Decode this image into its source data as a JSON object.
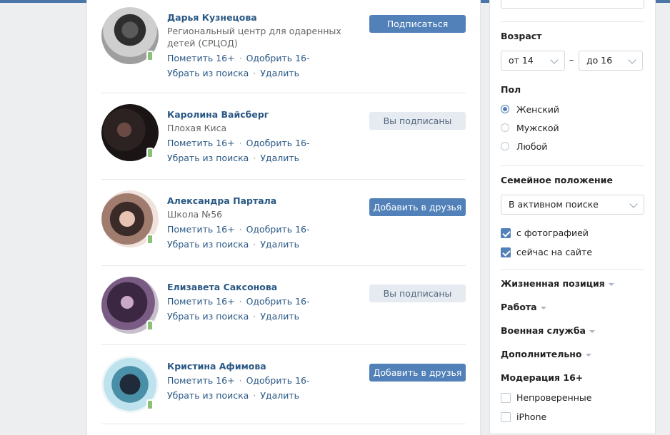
{
  "results": [
    {
      "name": "Дарья Кузнецова",
      "subtitle": "Региональный центр для одаренных детей (СРЦОД)",
      "action_label": "Подписаться",
      "action_style": "primary"
    },
    {
      "name": "Каролина Вайсберг",
      "subtitle": "Плохая Киса",
      "action_label": "Вы подписаны",
      "action_style": "secondary"
    },
    {
      "name": "Александра Партала",
      "subtitle": "Школа №56",
      "action_label": "Добавить в друзья",
      "action_style": "primary"
    },
    {
      "name": "Елизавета Саксонова",
      "subtitle": "",
      "action_label": "Вы подписаны",
      "action_style": "secondary"
    },
    {
      "name": "Кристина Афимова",
      "subtitle": "",
      "action_label": "Добавить в друзья",
      "action_style": "primary"
    }
  ],
  "moderation_links": {
    "mark_16": "Пометить 16+",
    "approve_16": "Одобрить 16-",
    "remove": "Убрать из поиска",
    "delete": "Удалить",
    "separator": "·"
  },
  "filters": {
    "age": {
      "title": "Возраст",
      "from": "от 14",
      "to": "до 16",
      "dash": "–"
    },
    "gender": {
      "title": "Пол",
      "options": [
        "Женский",
        "Мужской",
        "Любой"
      ],
      "selected": "Женский"
    },
    "relationship": {
      "title": "Семейное положение",
      "value": "В активном поиске"
    },
    "with_photo": {
      "label": "с фотографией",
      "checked": true
    },
    "online_now": {
      "label": "сейчас на сайте",
      "checked": true
    },
    "expandable": [
      "Жизненная позиция",
      "Работа",
      "Военная служба",
      "Дополнительно"
    ],
    "moderation": {
      "title": "Модерация 16+",
      "options": [
        {
          "label": "Непроверенные",
          "checked": false
        },
        {
          "label": "iPhone",
          "checked": false
        }
      ]
    }
  },
  "colors": {
    "accent": "#5181b8",
    "link": "#2a5885",
    "online_mobile": "#8ac176"
  }
}
